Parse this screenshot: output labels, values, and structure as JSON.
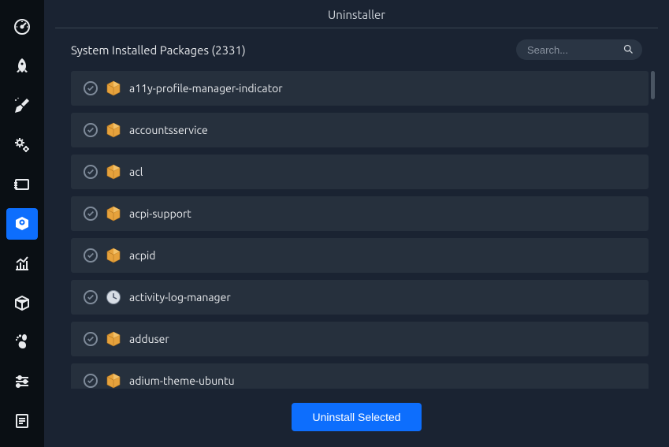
{
  "window": {
    "title": "Uninstaller"
  },
  "sidebar": {
    "items": [
      {
        "name": "dashboard",
        "icon": "gauge"
      },
      {
        "name": "startup",
        "icon": "rocket"
      },
      {
        "name": "cleaner",
        "icon": "broom"
      },
      {
        "name": "services",
        "icon": "gears"
      },
      {
        "name": "process",
        "icon": "window"
      },
      {
        "name": "uninstaller",
        "icon": "package-eye",
        "active": true
      },
      {
        "name": "resources",
        "icon": "chart"
      },
      {
        "name": "apt",
        "icon": "box"
      },
      {
        "name": "gnome",
        "icon": "foot"
      },
      {
        "name": "settings",
        "icon": "sliders"
      },
      {
        "name": "log",
        "icon": "log"
      }
    ]
  },
  "header": {
    "title_prefix": "System Installed Packages",
    "count": 2331,
    "title": "System Installed Packages (2331)"
  },
  "search": {
    "placeholder": "Search..."
  },
  "packages": [
    {
      "name": "a11y-profile-manager-indicator",
      "icon": "pkg"
    },
    {
      "name": "accountsservice",
      "icon": "pkg"
    },
    {
      "name": "acl",
      "icon": "pkg"
    },
    {
      "name": "acpi-support",
      "icon": "pkg"
    },
    {
      "name": "acpid",
      "icon": "pkg"
    },
    {
      "name": "activity-log-manager",
      "icon": "clock"
    },
    {
      "name": "adduser",
      "icon": "pkg"
    },
    {
      "name": "adium-theme-ubuntu",
      "icon": "pkg"
    }
  ],
  "footer": {
    "uninstall_label": "Uninstall Selected"
  }
}
